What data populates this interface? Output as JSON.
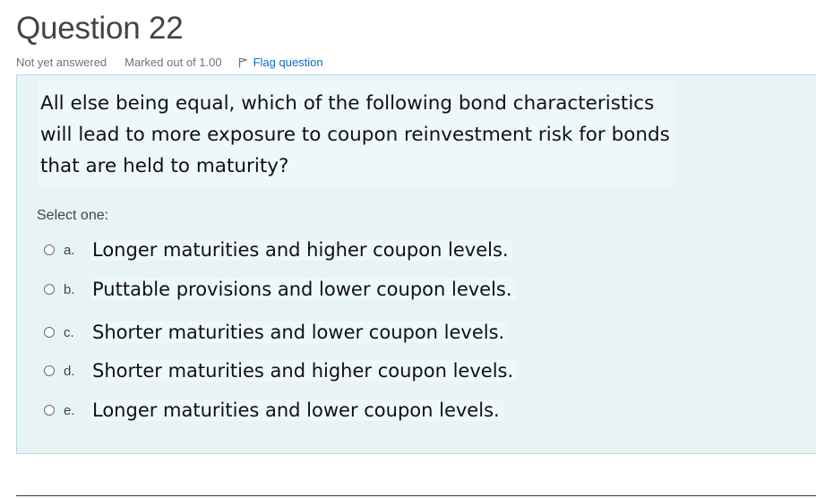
{
  "question": {
    "title": "Question 22",
    "status": "Not yet answered",
    "marks": "Marked out of 1.00",
    "flag_label": "Flag question",
    "text": "All else being equal, which of the following bond characteristics will lead to more exposure to coupon reinvestment risk for bonds that are held to maturity?",
    "prompt": "Select one:",
    "answers": [
      {
        "letter": "a.",
        "text": "Longer maturities and higher coupon levels."
      },
      {
        "letter": "b.",
        "text": "Puttable provisions and lower coupon levels."
      },
      {
        "letter": "c.",
        "text": "Shorter maturities and lower coupon levels."
      },
      {
        "letter": "d.",
        "text": "Shorter maturities and higher coupon levels."
      },
      {
        "letter": "e.",
        "text": "Longer maturities and lower coupon levels."
      }
    ]
  },
  "colors": {
    "formulation_bg": "#e7f3f5",
    "link": "#0f6cbf"
  }
}
